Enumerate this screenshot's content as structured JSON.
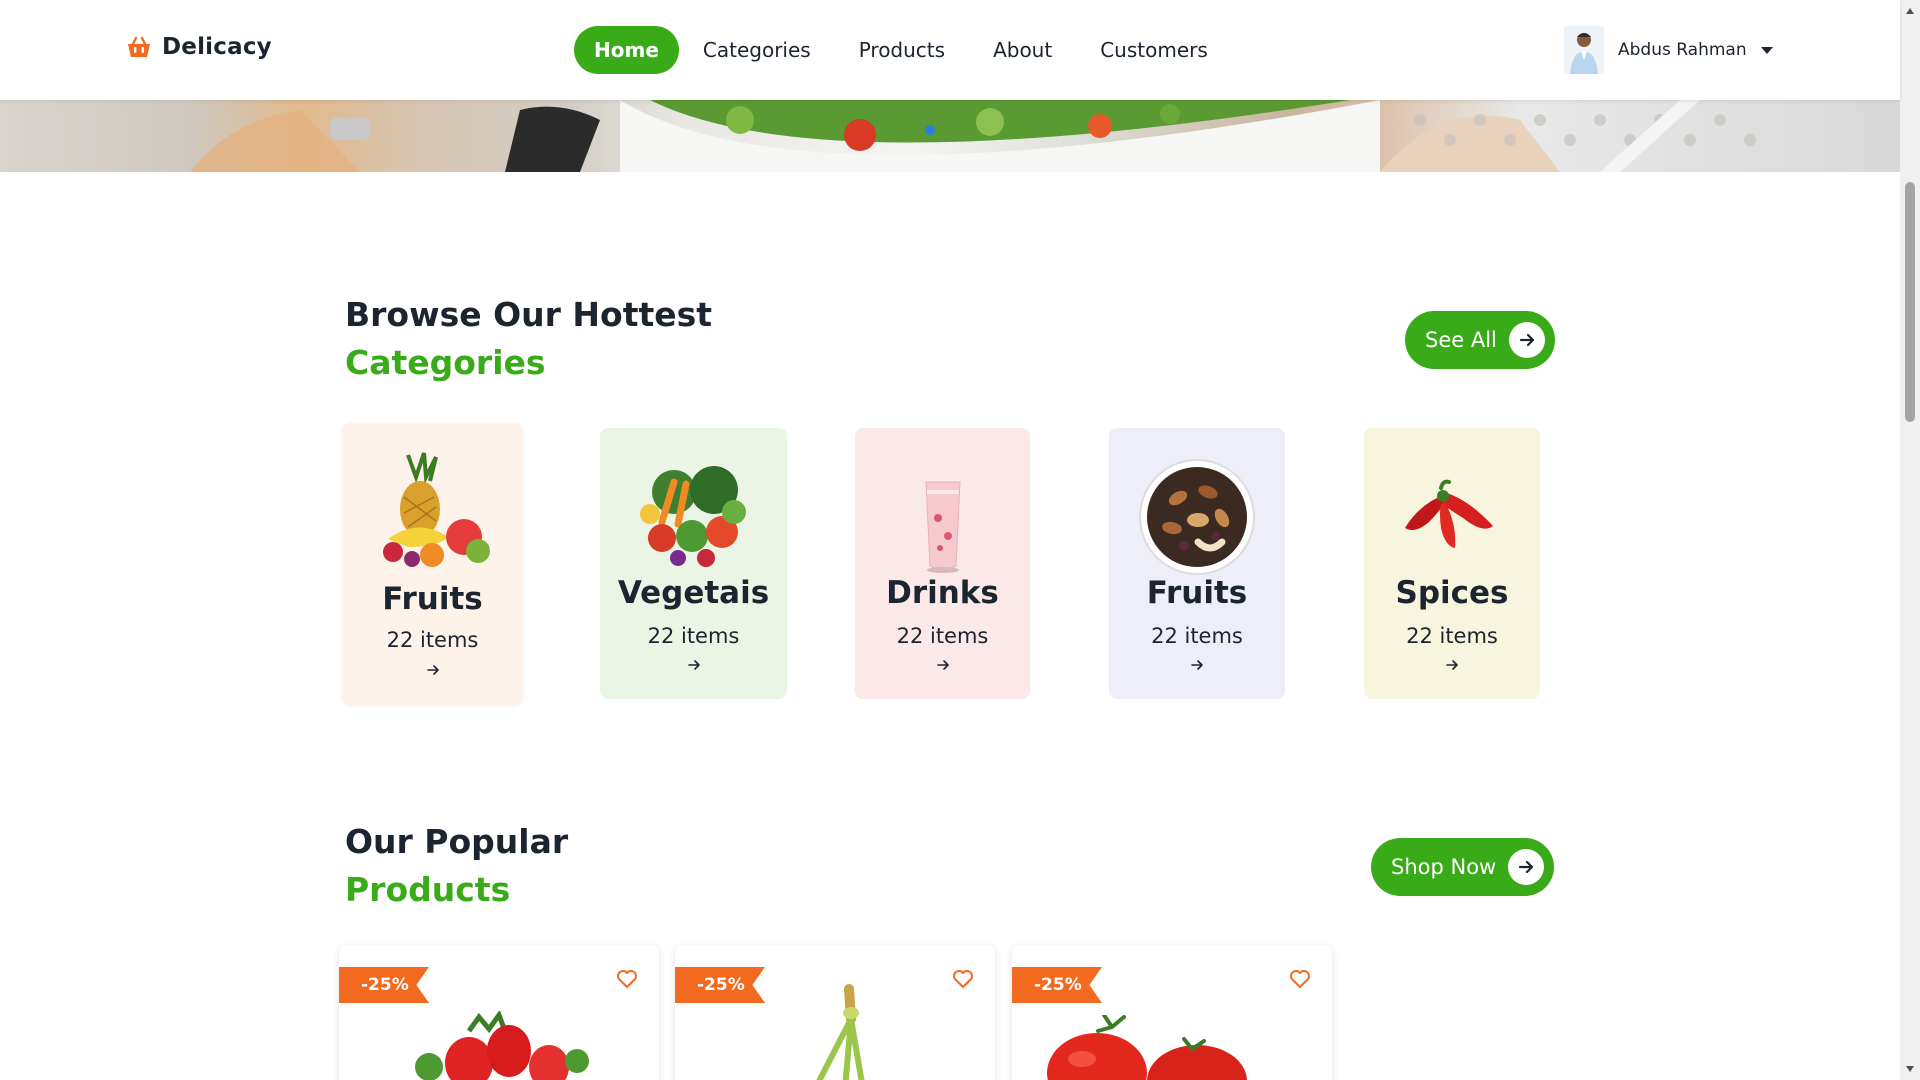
{
  "brand": {
    "name": "Delicacy",
    "icon": "basket-icon",
    "accent": "#3aab18",
    "orange": "#f26a1f"
  },
  "nav": {
    "items": [
      {
        "label": "Home",
        "active": true
      },
      {
        "label": "Categories",
        "active": false
      },
      {
        "label": "Products",
        "active": false
      },
      {
        "label": "About",
        "active": false
      },
      {
        "label": "Customers",
        "active": false
      }
    ]
  },
  "user": {
    "name": "Abdus Rahman",
    "menu_icon": "caret-down-icon"
  },
  "categories_section": {
    "title": "Browse Our Hottest",
    "subtitle": "Categories",
    "button_label": "See All",
    "items": [
      {
        "name": "Fruits",
        "count": "22 items",
        "image": "fruit-basket",
        "bg": "#fdf3ea"
      },
      {
        "name": "Vegetais",
        "count": "22 items",
        "image": "vegetables",
        "bg": "#ebf5e6"
      },
      {
        "name": "Drinks",
        "count": "22 items",
        "image": "smoothie-glass",
        "bg": "#fbe9e9"
      },
      {
        "name": "Fruits",
        "count": "22 items",
        "image": "mixed-nuts",
        "bg": "#eeeef8"
      },
      {
        "name": "Spices",
        "count": "22 items",
        "image": "red-chilies",
        "bg": "#f8f5de"
      }
    ]
  },
  "products_section": {
    "title": "Our Popular",
    "subtitle": "Products",
    "button_label": "Shop Now",
    "items": [
      {
        "discount": "-25%",
        "image": "strawberries"
      },
      {
        "discount": "-25%",
        "image": "lemongrass"
      },
      {
        "discount": "-25%",
        "image": "tomatoes"
      }
    ]
  }
}
